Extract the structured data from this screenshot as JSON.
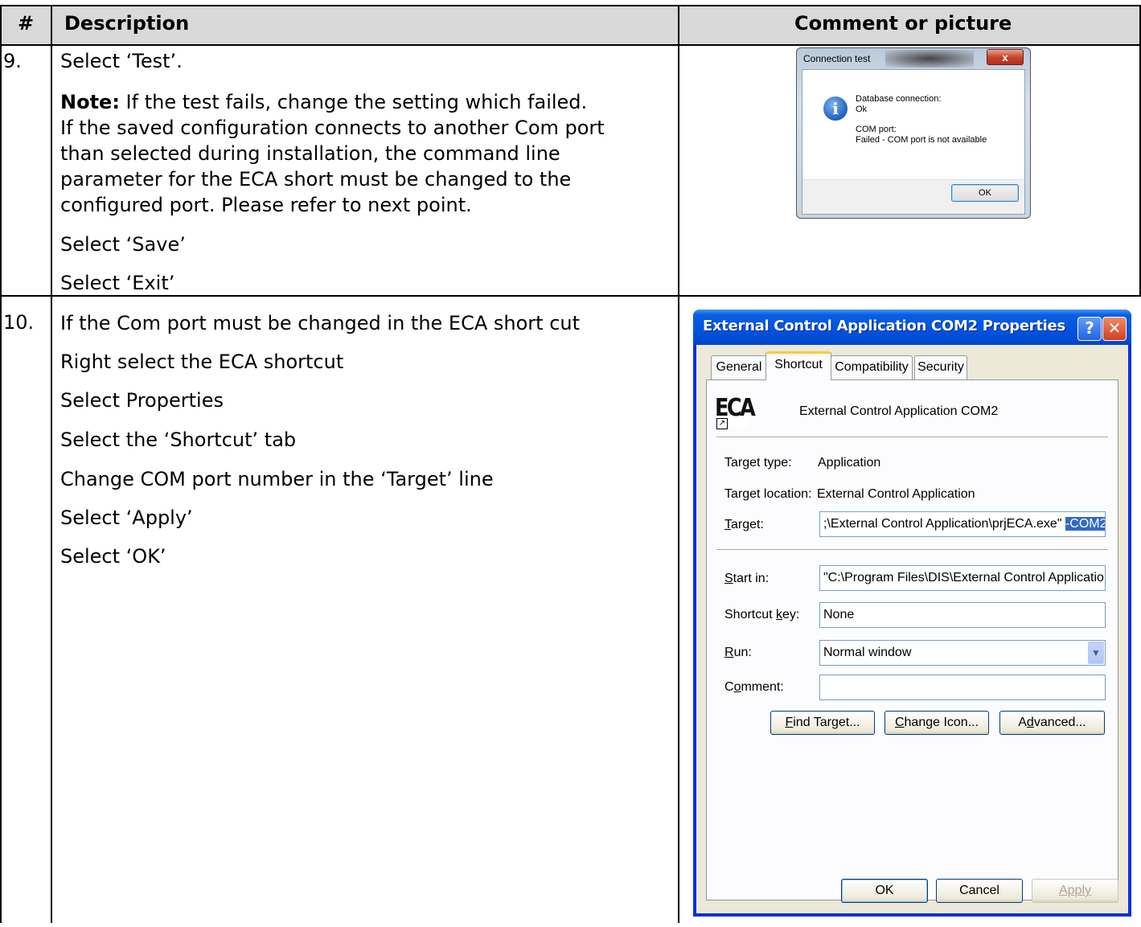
{
  "table": {
    "headers": {
      "num": "#",
      "description": "Description",
      "comment": "Comment or picture"
    },
    "row9": {
      "num": "9.",
      "lines": {
        "l1": "Select ‘Test’.",
        "note_label": "Note:",
        "note_l1": " If the test fails, change the setting which failed.",
        "note_l2": "If the saved configuration connects to another Com port",
        "note_l3": "than selected during installation, the command line",
        "note_l4": "parameter for the ECA short must be changed to the",
        "note_l5": "configured port. Please refer to next point.",
        "save": "Select ‘Save’",
        "exit": "Select ‘Exit’"
      }
    },
    "row10": {
      "num": "10.",
      "lines": [
        "If the Com port must be changed in the ECA short cut",
        "Right select the ECA shortcut",
        "Select Properties",
        "Select the ‘Shortcut’ tab",
        "Change COM port number in the ‘Target’ line",
        "Select ‘Apply’",
        "Select ‘OK’"
      ]
    }
  },
  "connection_dialog": {
    "title": "Connection test",
    "close_label": "x",
    "icon_glyph": "i",
    "db_label": "Database connection:",
    "db_value": "Ok",
    "com_label": "COM port:",
    "com_value": "Failed - COM port is not available",
    "ok_label": "OK"
  },
  "properties_dialog": {
    "title": "External Control Application COM2 Properties",
    "help_glyph": "?",
    "close_glyph": "✕",
    "tabs": {
      "general": "General",
      "shortcut": "Shortcut",
      "compatibility": "Compatibility",
      "security": "Security"
    },
    "app_icon_text": "ECA",
    "app_name": "External Control Application COM2",
    "target_type_label": "Target type:",
    "target_type_value": "Application",
    "target_location_label": "Target location:",
    "target_location_value": "External Control Application",
    "target_label_u": "T",
    "target_label_rest": "arget:",
    "target_value": ";\\External Control Application\\prjECA.exe\" ",
    "target_value_selected": "-COM2",
    "start_in_label_u": "S",
    "start_in_label_rest": "tart in:",
    "start_in_value": "\"C:\\Program Files\\DIS\\External Control Applicatio",
    "shortcut_key_label_a": "Shortcut ",
    "shortcut_key_label_u": "k",
    "shortcut_key_label_b": "ey:",
    "shortcut_key_value": "None",
    "run_label_u": "R",
    "run_label_rest": "un:",
    "run_value": "Normal window",
    "comment_label_a": "C",
    "comment_label_u": "o",
    "comment_label_b": "mment:",
    "comment_value": "",
    "find_target_u": "F",
    "find_target_rest": "ind Target...",
    "change_icon_u": "C",
    "change_icon_rest": "hange Icon...",
    "advanced_a": "A",
    "advanced_u": "d",
    "advanced_b": "vanced...",
    "ok_label": "OK",
    "cancel_label": "Cancel",
    "apply_label": "Apply"
  }
}
